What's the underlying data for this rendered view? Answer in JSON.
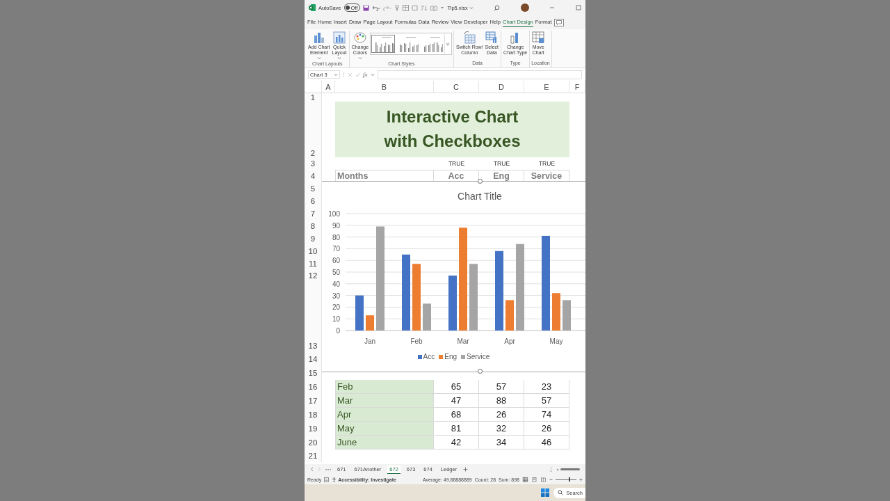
{
  "title_bar": {
    "autosave_label": "AutoSave",
    "autosave": {
      "on": false,
      "label": "Off"
    },
    "file_name": "Tip5.xlsx"
  },
  "menu_tabs": [
    {
      "label": "File",
      "selected": false
    },
    {
      "label": "Home",
      "selected": false
    },
    {
      "label": "Insert",
      "selected": false
    },
    {
      "label": "Draw",
      "selected": false
    },
    {
      "label": "Page Layout",
      "selected": false
    },
    {
      "label": "Formulas",
      "selected": false
    },
    {
      "label": "Data",
      "selected": false
    },
    {
      "label": "Review",
      "selected": false
    },
    {
      "label": "View",
      "selected": false
    },
    {
      "label": "Developer",
      "selected": false
    },
    {
      "label": "Help",
      "selected": false
    },
    {
      "label": "Chart Design",
      "selected": true
    },
    {
      "label": "Format",
      "selected": false
    }
  ],
  "ribbon_groups": [
    {
      "label": "Chart Layouts",
      "buttons": [
        {
          "kind": "add-element",
          "label": "Add Chart\nElement",
          "dropdown": true
        },
        {
          "kind": "quick-layout",
          "label": "Quick\nLayout",
          "dropdown": true
        }
      ]
    },
    {
      "label": "Chart Styles",
      "buttons": [
        {
          "kind": "colors",
          "label": "Change\nColors",
          "dropdown": true
        }
      ],
      "styles": [
        {
          "selected": true
        },
        {
          "selected": false
        },
        {
          "selected": false
        }
      ]
    },
    {
      "label": "Data",
      "buttons": [
        {
          "kind": "switch",
          "label": "Switch Row/\nColumn",
          "dropdown": false
        },
        {
          "kind": "select-data",
          "label": "Select\nData",
          "dropdown": false
        }
      ]
    },
    {
      "label": "Type",
      "buttons": [
        {
          "kind": "chart-type",
          "label": "Change\nChart Type",
          "dropdown": false
        }
      ]
    },
    {
      "label": "Location",
      "buttons": [
        {
          "kind": "move-chart",
          "label": "Move\nChart",
          "dropdown": false
        }
      ]
    }
  ],
  "formula_bar": {
    "name_box": "Chart 3",
    "fx": "fx"
  },
  "column_headers": [
    "A",
    "B",
    "C",
    "D",
    "E",
    "F"
  ],
  "rows": [
    {
      "number": "1",
      "kind": "blank"
    },
    {
      "number": "2",
      "kind": "title",
      "values": [
        "Interactive Chart\nwith Checkboxes"
      ]
    },
    {
      "number": "3",
      "kind": "flags",
      "values": [
        "TRUE",
        "TRUE",
        "TRUE"
      ]
    },
    {
      "number": "4",
      "kind": "header",
      "values": [
        "Months",
        "Acc",
        "Eng",
        "Service"
      ]
    },
    {
      "number": "5",
      "kind": "blank"
    },
    {
      "number": "6",
      "kind": "blank"
    },
    {
      "number": "7",
      "kind": "blank"
    },
    {
      "number": "8",
      "kind": "blank"
    },
    {
      "number": "9",
      "kind": "blank"
    },
    {
      "number": "10",
      "kind": "blank"
    },
    {
      "number": "11",
      "kind": "blank"
    },
    {
      "number": "12",
      "kind": "blank"
    },
    {
      "number": "13",
      "kind": "blank"
    },
    {
      "number": "14",
      "kind": "blank"
    },
    {
      "number": "15",
      "kind": "blank"
    },
    {
      "number": "16",
      "kind": "data",
      "values": [
        "Feb",
        "65",
        "57",
        "23"
      ]
    },
    {
      "number": "17",
      "kind": "data",
      "values": [
        "Mar",
        "47",
        "88",
        "57"
      ]
    },
    {
      "number": "18",
      "kind": "data",
      "values": [
        "Apr",
        "68",
        "26",
        "74"
      ]
    },
    {
      "number": "19",
      "kind": "data",
      "values": [
        "May",
        "81",
        "32",
        "26"
      ]
    },
    {
      "number": "20",
      "kind": "data",
      "values": [
        "June",
        "42",
        "34",
        "46"
      ]
    },
    {
      "number": "21",
      "kind": "blank"
    }
  ],
  "chart": {
    "selected": true,
    "chart_data": {
      "type": "bar",
      "title": "Chart Title",
      "categories": [
        "Jan",
        "Feb",
        "Mar",
        "Apr",
        "May"
      ],
      "series": [
        {
          "name": "Acc",
          "color": "#4472c4",
          "values": [
            30,
            65,
            47,
            68,
            81
          ]
        },
        {
          "name": "Eng",
          "color": "#ed7d31",
          "values": [
            13,
            57,
            88,
            26,
            32
          ]
        },
        {
          "name": "Service",
          "color": "#a5a5a5",
          "values": [
            89,
            23,
            57,
            74,
            26
          ]
        }
      ],
      "ylim": [
        0,
        100
      ],
      "yticks": [
        0,
        10,
        20,
        30,
        40,
        50,
        60,
        70,
        80,
        90,
        100
      ],
      "grid": true,
      "legend": true
    }
  },
  "sheet_tabs": [
    {
      "label": "671",
      "selected": false
    },
    {
      "label": "671Another",
      "selected": false
    },
    {
      "label": "672",
      "selected": true
    },
    {
      "label": "673",
      "selected": false
    },
    {
      "label": "674",
      "selected": false
    },
    {
      "label": "Ledger",
      "selected": false
    }
  ],
  "status_bar": {
    "mode": "Ready",
    "accessibility": "Accessibility: Investigate",
    "average": "Average: 49.88888889",
    "count": "Count: 28",
    "sum": "Sum: 898",
    "views": [
      {
        "selected": true
      },
      {
        "selected": false
      },
      {
        "selected": false
      }
    ],
    "zoom": {
      "level": 0.62
    }
  },
  "taskbar": {
    "search_placeholder": "Search"
  }
}
